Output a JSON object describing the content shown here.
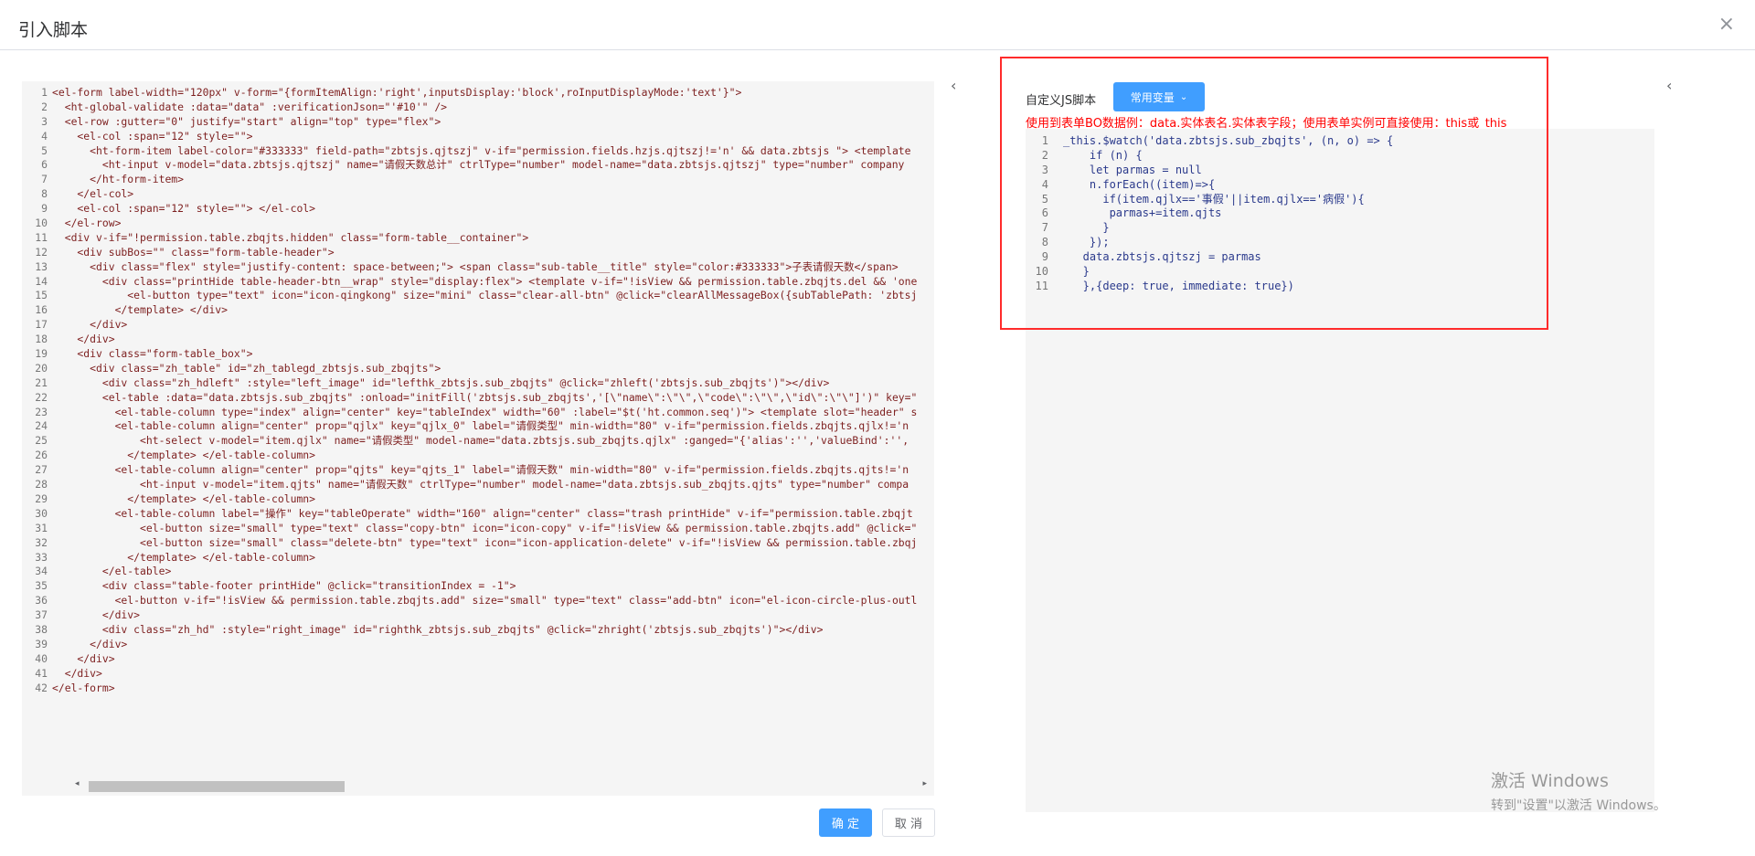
{
  "dialog": {
    "title": "引入脚本",
    "close_icon": "×"
  },
  "left_editor": {
    "lines": [
      "<el-form label-width=\"120px\" v-form=\"{formItemAlign:'right',inputsDisplay:'block',roInputDisplayMode:'text'}\">",
      "  <ht-global-validate :data=\"data\" :verificationJson=\"'#10'\" />",
      "  <el-row :gutter=\"0\" justify=\"start\" align=\"top\" type=\"flex\">",
      "    <el-col :span=\"12\" style=\"\">",
      "      <ht-form-item label-color=\"#333333\" field-path=\"zbtsjs.qjtszj\" v-if=\"permission.fields.hzjs.qjtszj!='n' && data.zbtsjs \"> <template",
      "        <ht-input v-model=\"data.zbtsjs.qjtszj\" name=\"请假天数总计\" ctrlType=\"number\" model-name=\"data.zbtsjs.qjtszj\" type=\"number\" company",
      "      </ht-form-item>",
      "    </el-col>",
      "    <el-col :span=\"12\" style=\"\"> </el-col>",
      "  </el-row>",
      "  <div v-if=\"!permission.table.zbqjts.hidden\" class=\"form-table__container\">",
      "    <div subBos=\"\" class=\"form-table-header\">",
      "      <div class=\"flex\" style=\"justify-content: space-between;\"> <span class=\"sub-table__title\" style=\"color:#333333\">子表请假天数</span>",
      "        <div class=\"printHide table-header-btn__wrap\" style=\"display:flex\"> <template v-if=\"!isView && permission.table.zbqjts.del && 'one",
      "            <el-button type=\"text\" icon=\"icon-qingkong\" size=\"mini\" class=\"clear-all-btn\" @click=\"clearAllMessageBox({subTablePath: 'zbtsj",
      "          </template> </div>",
      "      </div>",
      "    </div>",
      "    <div class=\"form-table_box\">",
      "      <div class=\"zh_table\" id=\"zh_tablegd_zbtsjs.sub_zbqjts\">",
      "        <div class=\"zh_hdleft\" :style=\"left_image\" id=\"lefthk_zbtsjs.sub_zbqjts\" @click=\"zhleft('zbtsjs.sub_zbqjts')\"></div>",
      "        <el-table :data=\"data.zbtsjs.sub_zbqjts\" :onload=\"initFill('zbtsjs.sub_zbqjts','[\\\"name\\\":\\\"\\\",\\\"code\\\":\\\"\\\",\\\"id\\\":\\\"\\\"]')\" key=\"",
      "          <el-table-column type=\"index\" align=\"center\" key=\"tableIndex\" width=\"60\" :label=\"$t('ht.common.seq')\"> <template slot=\"header\" s",
      "          <el-table-column align=\"center\" prop=\"qjlx\" key=\"qjlx_0\" label=\"请假类型\" min-width=\"80\" v-if=\"permission.fields.zbqjts.qjlx!='n",
      "              <ht-select v-model=\"item.qjlx\" name=\"请假类型\" model-name=\"data.zbtsjs.sub_zbqjts.qjlx\" :ganged=\"{'alias':'','valueBind':'',",
      "            </template> </el-table-column>",
      "          <el-table-column align=\"center\" prop=\"qjts\" key=\"qjts_1\" label=\"请假天数\" min-width=\"80\" v-if=\"permission.fields.zbqjts.qjts!='n",
      "              <ht-input v-model=\"item.qjts\" name=\"请假天数\" ctrlType=\"number\" model-name=\"data.zbtsjs.sub_zbqjts.qjts\" type=\"number\" compa",
      "            </template> </el-table-column>",
      "          <el-table-column label=\"操作\" key=\"tableOperate\" width=\"160\" align=\"center\" class=\"trash printHide\" v-if=\"permission.table.zbqjt",
      "              <el-button size=\"small\" type=\"text\" class=\"copy-btn\" icon=\"icon-copy\" v-if=\"!isView && permission.table.zbqjts.add\" @click=\"",
      "              <el-button size=\"small\" class=\"delete-btn\" type=\"text\" icon=\"icon-application-delete\" v-if=\"!isView && permission.table.zbqj",
      "            </template> </el-table-column>",
      "        </el-table>",
      "        <div class=\"table-footer printHide\" @click=\"transitionIndex = -1\">",
      "          <el-button v-if=\"!isView && permission.table.zbqjts.add\" size=\"small\" type=\"text\" class=\"add-btn\" icon=\"el-icon-circle-plus-outl",
      "        </div>",
      "        <div class=\"zh_hd\" :style=\"right_image\" id=\"righthk_zbtsjs.sub_zbqjts\" @click=\"zhright('zbtsjs.sub_zbqjts')\"></div>",
      "      </div>",
      "    </div>",
      "  </div>",
      "</el-form>"
    ]
  },
  "collapse_icons": {
    "left": "‹",
    "right": "‹"
  },
  "right_panel": {
    "label": "自定义JS脚本",
    "vars_button": "常用变量",
    "vars_chevron": "⌄",
    "hint": "使用到表单BO数据例：data.实体表名.实体表字段；使用表单实例可直接使用：this或_this",
    "lines": [
      "_this.$watch('data.zbtsjs.sub_zbqjts', (n, o) => {",
      "    if (n) {",
      "    let parmas = null",
      "    n.forEach((item)=>{",
      "      if(item.qjlx=='事假'||item.qjlx=='病假'){",
      "       parmas+=item.qjts",
      "      }",
      "    });",
      "   data.zbtsjs.qjtszj = parmas",
      "   }",
      "   },{deep: true, immediate: true})"
    ]
  },
  "watermark": {
    "line1": "激活 Windows",
    "line2": "转到\"设置\"以激活 Windows。"
  },
  "footer": {
    "ok": "确 定",
    "cancel": "取 消"
  },
  "colors": {
    "primary": "#409eff",
    "annotation": "#ff2b2b",
    "hint": "#ff0000"
  }
}
